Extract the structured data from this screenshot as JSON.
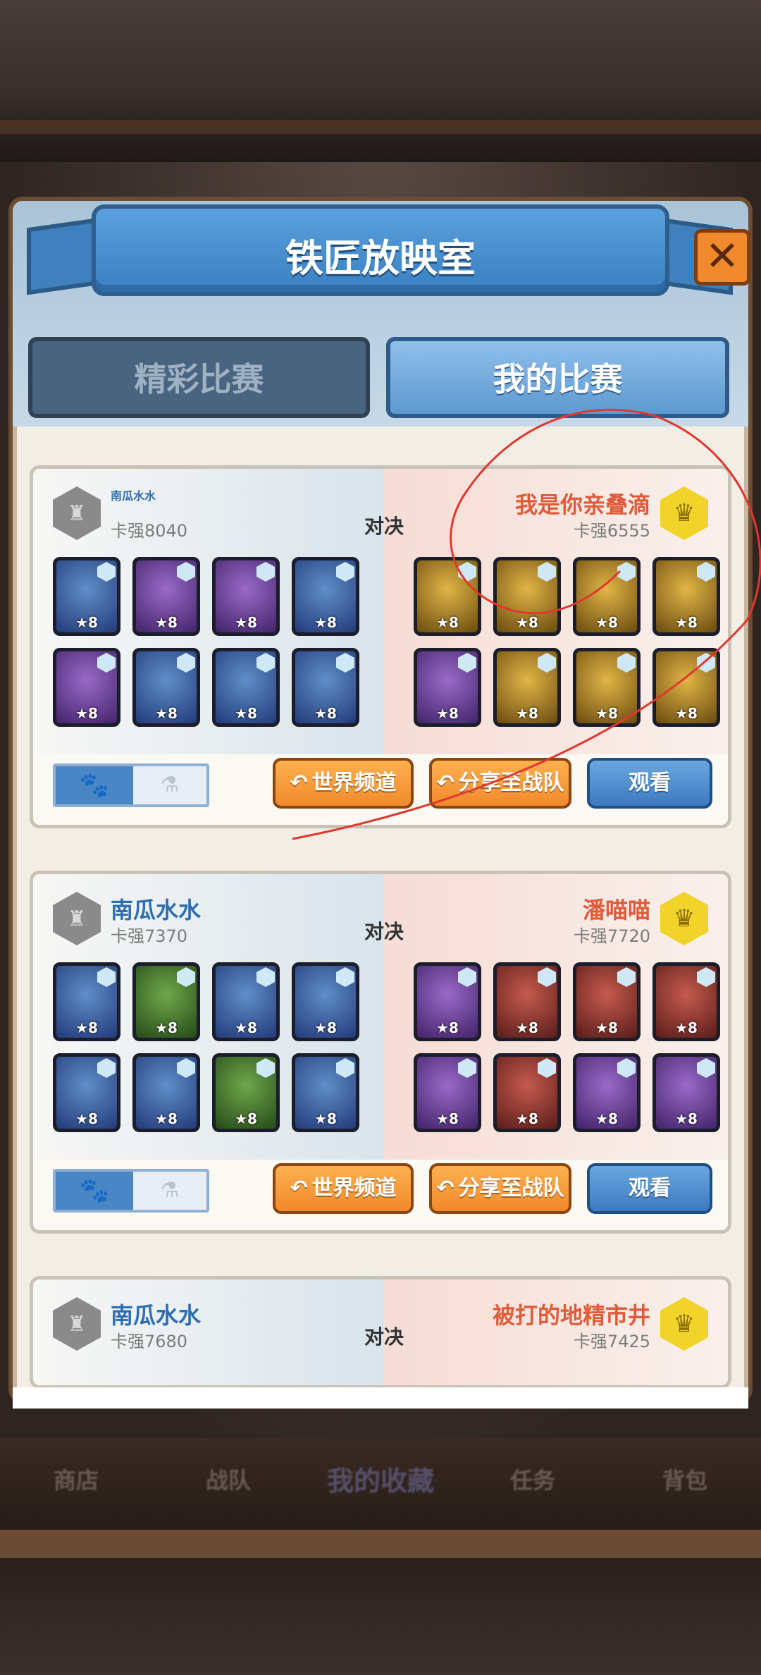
{
  "dialog": {
    "title": "铁匠放映室",
    "close_icon": "close-icon",
    "tabs": [
      {
        "label": "精彩比赛",
        "active": false
      },
      {
        "label": "我的比赛",
        "active": true
      }
    ]
  },
  "match_label": "对决",
  "matches": [
    {
      "left": {
        "name": "南瓜水水",
        "power": "卡强8040"
      },
      "right": {
        "name": "我是你亲叠滴",
        "power": "卡强6555"
      },
      "left_units": [
        {
          "color": "c-blue",
          "star": "★8"
        },
        {
          "color": "c-purple",
          "star": "★8"
        },
        {
          "color": "c-purple",
          "star": "★8"
        },
        {
          "color": "c-blue",
          "star": "★8"
        },
        {
          "color": "c-purple",
          "star": "★8"
        },
        {
          "color": "c-blue",
          "star": "★8"
        },
        {
          "color": "c-blue",
          "star": "★8"
        },
        {
          "color": "c-blue",
          "star": "★8"
        }
      ],
      "right_units": [
        {
          "color": "c-gold",
          "star": "★8"
        },
        {
          "color": "c-gold",
          "star": "★8"
        },
        {
          "color": "c-gold",
          "star": "★8"
        },
        {
          "color": "c-gold",
          "star": "★8"
        },
        {
          "color": "c-purple",
          "star": "★8"
        },
        {
          "color": "c-gold",
          "star": "★8"
        },
        {
          "color": "c-gold",
          "star": "★8"
        },
        {
          "color": "c-gold",
          "star": "★8"
        }
      ],
      "buttons": {
        "world": "世界频道",
        "share": "分享至战队",
        "watch": "观看"
      }
    },
    {
      "left": {
        "name": "南瓜水水",
        "power": "卡强7370"
      },
      "right": {
        "name": "潘喵喵",
        "power": "卡强7720"
      },
      "left_units": [
        {
          "color": "c-blue",
          "star": "★8"
        },
        {
          "color": "c-green",
          "star": "★8"
        },
        {
          "color": "c-blue",
          "star": "★8"
        },
        {
          "color": "c-blue",
          "star": "★8"
        },
        {
          "color": "c-blue",
          "star": "★8"
        },
        {
          "color": "c-blue",
          "star": "★8"
        },
        {
          "color": "c-green",
          "star": "★8"
        },
        {
          "color": "c-blue",
          "star": "★8"
        }
      ],
      "right_units": [
        {
          "color": "c-purple",
          "star": "★8"
        },
        {
          "color": "c-red",
          "star": "★8"
        },
        {
          "color": "c-red",
          "star": "★8"
        },
        {
          "color": "c-red",
          "star": "★8"
        },
        {
          "color": "c-purple",
          "star": "★8"
        },
        {
          "color": "c-red",
          "star": "★8"
        },
        {
          "color": "c-purple",
          "star": "★8"
        },
        {
          "color": "c-purple",
          "star": "★8"
        }
      ],
      "buttons": {
        "world": "世界频道",
        "share": "分享至战队",
        "watch": "观看"
      }
    },
    {
      "left": {
        "name": "南瓜水水",
        "power": "卡强7680"
      },
      "right": {
        "name": "被打的地精市井",
        "power": "卡强7425"
      }
    }
  ],
  "bottom_nav": [
    "商店",
    "战队",
    "我的收藏",
    "任务",
    "背包"
  ],
  "colors": {
    "accent_blue": "#3c7ac0",
    "orange": "#f08a2c",
    "left_name": "#2d6eb0",
    "right_name": "#df5b3a"
  }
}
